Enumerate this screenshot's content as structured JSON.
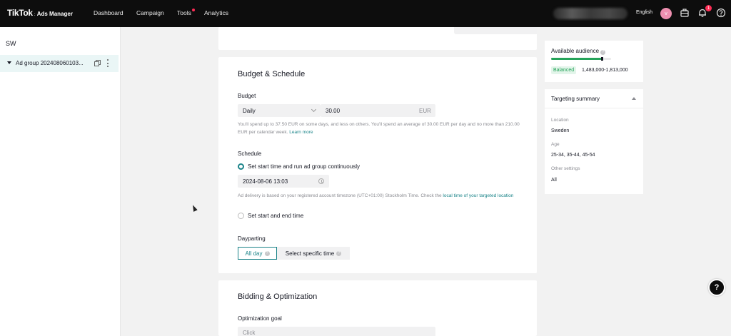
{
  "topbar": {
    "brand": "TikTok",
    "separator": ":",
    "product": "Ads Manager",
    "nav": [
      "Dashboard",
      "Campaign",
      "Tools",
      "Analytics"
    ],
    "language": "English",
    "avatar_initial": "v",
    "notification_count": "1"
  },
  "sidebar": {
    "account_label": "SW",
    "ad_group_label": "Ad group 202408060103..."
  },
  "budget": {
    "section_title": "Budget & Schedule",
    "budget_label": "Budget",
    "budget_type": "Daily",
    "budget_amount": "30.00",
    "currency": "EUR",
    "budget_help": "You'll spend up to 37.50 EUR on some days, and less on others. You'll spend an average of 30.00 EUR per day and no more than 210.00 EUR per calendar week.",
    "learn_more": "Learn more",
    "schedule_label": "Schedule",
    "schedule_option_1": "Set start time and run ad group continuously",
    "start_datetime": "2024-08-06 13:03",
    "timezone_help": "Ad delivery is based on your registered account timezone (UTC+01:00) Stockholm Time. Check the",
    "local_time_link": "local time of your targeted location",
    "schedule_option_2": "Set start and end time",
    "dayparting_label": "Dayparting",
    "dayparting_all_day": "All day",
    "dayparting_specific": "Select specific time"
  },
  "bidding": {
    "section_title": "Bidding & Optimization",
    "optimization_goal_label": "Optimization goal",
    "optimization_goal_value": "Click"
  },
  "audience": {
    "title": "Available audience",
    "status": "Balanced",
    "range": "1,483,000-1,813,000",
    "meter_level": 0.85
  },
  "targeting": {
    "title": "Targeting summary",
    "location_label": "Location",
    "location_value": "Sweden",
    "age_label": "Age",
    "age_value": "25-34, 35-44, 45-54",
    "other_label": "Other settings",
    "other_value": "All"
  },
  "help_fab": "?",
  "colors": {
    "accent": "#1b8489",
    "topbar": "#0d0d0d",
    "success": "#25a35a",
    "badge": "#fe2c55"
  }
}
